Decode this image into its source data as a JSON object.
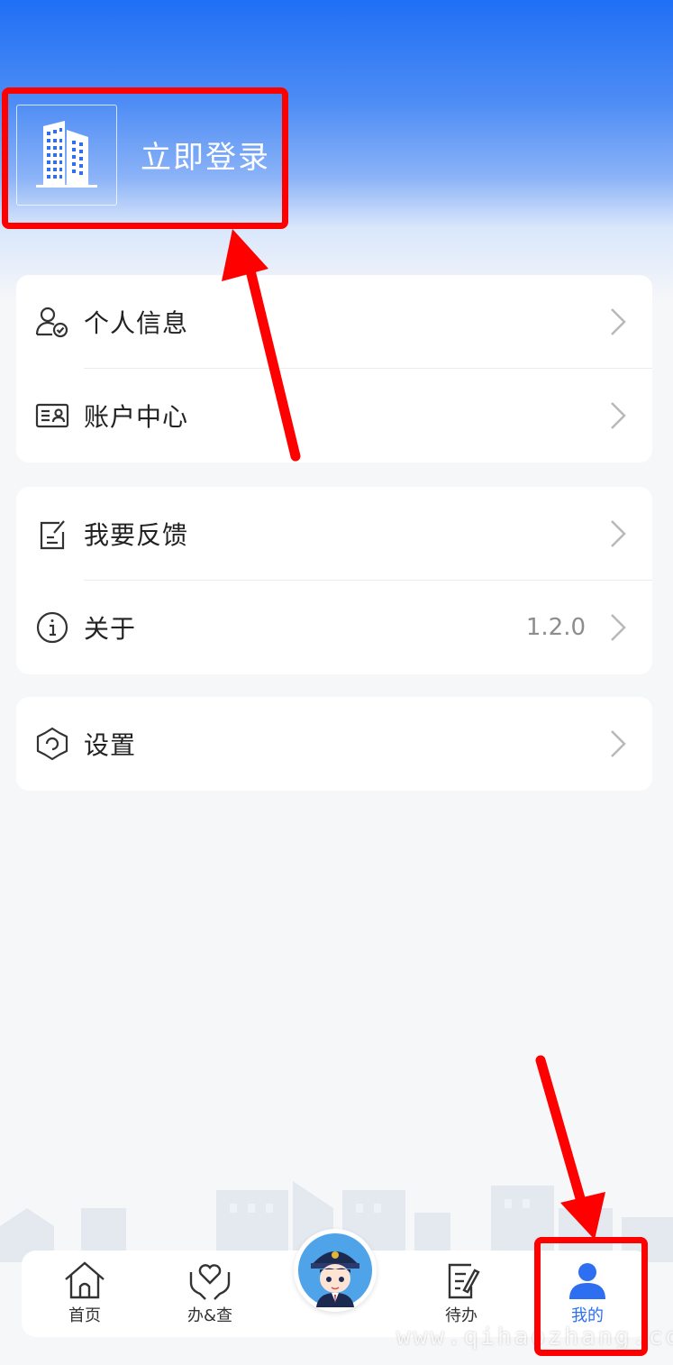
{
  "header": {
    "login_label": "立即登录"
  },
  "menu": {
    "personal_info": "个人信息",
    "account_center": "账户中心",
    "feedback": "我要反馈",
    "about": "关于",
    "about_version": "1.2.0",
    "settings": "设置"
  },
  "tabbar": {
    "home": "首页",
    "handle_query": "办&查",
    "todo": "待办",
    "mine": "我的"
  },
  "watermark": "www.qihaozhang.com",
  "colors": {
    "primary": "#2d6ff0",
    "annotation": "#ff0000"
  }
}
